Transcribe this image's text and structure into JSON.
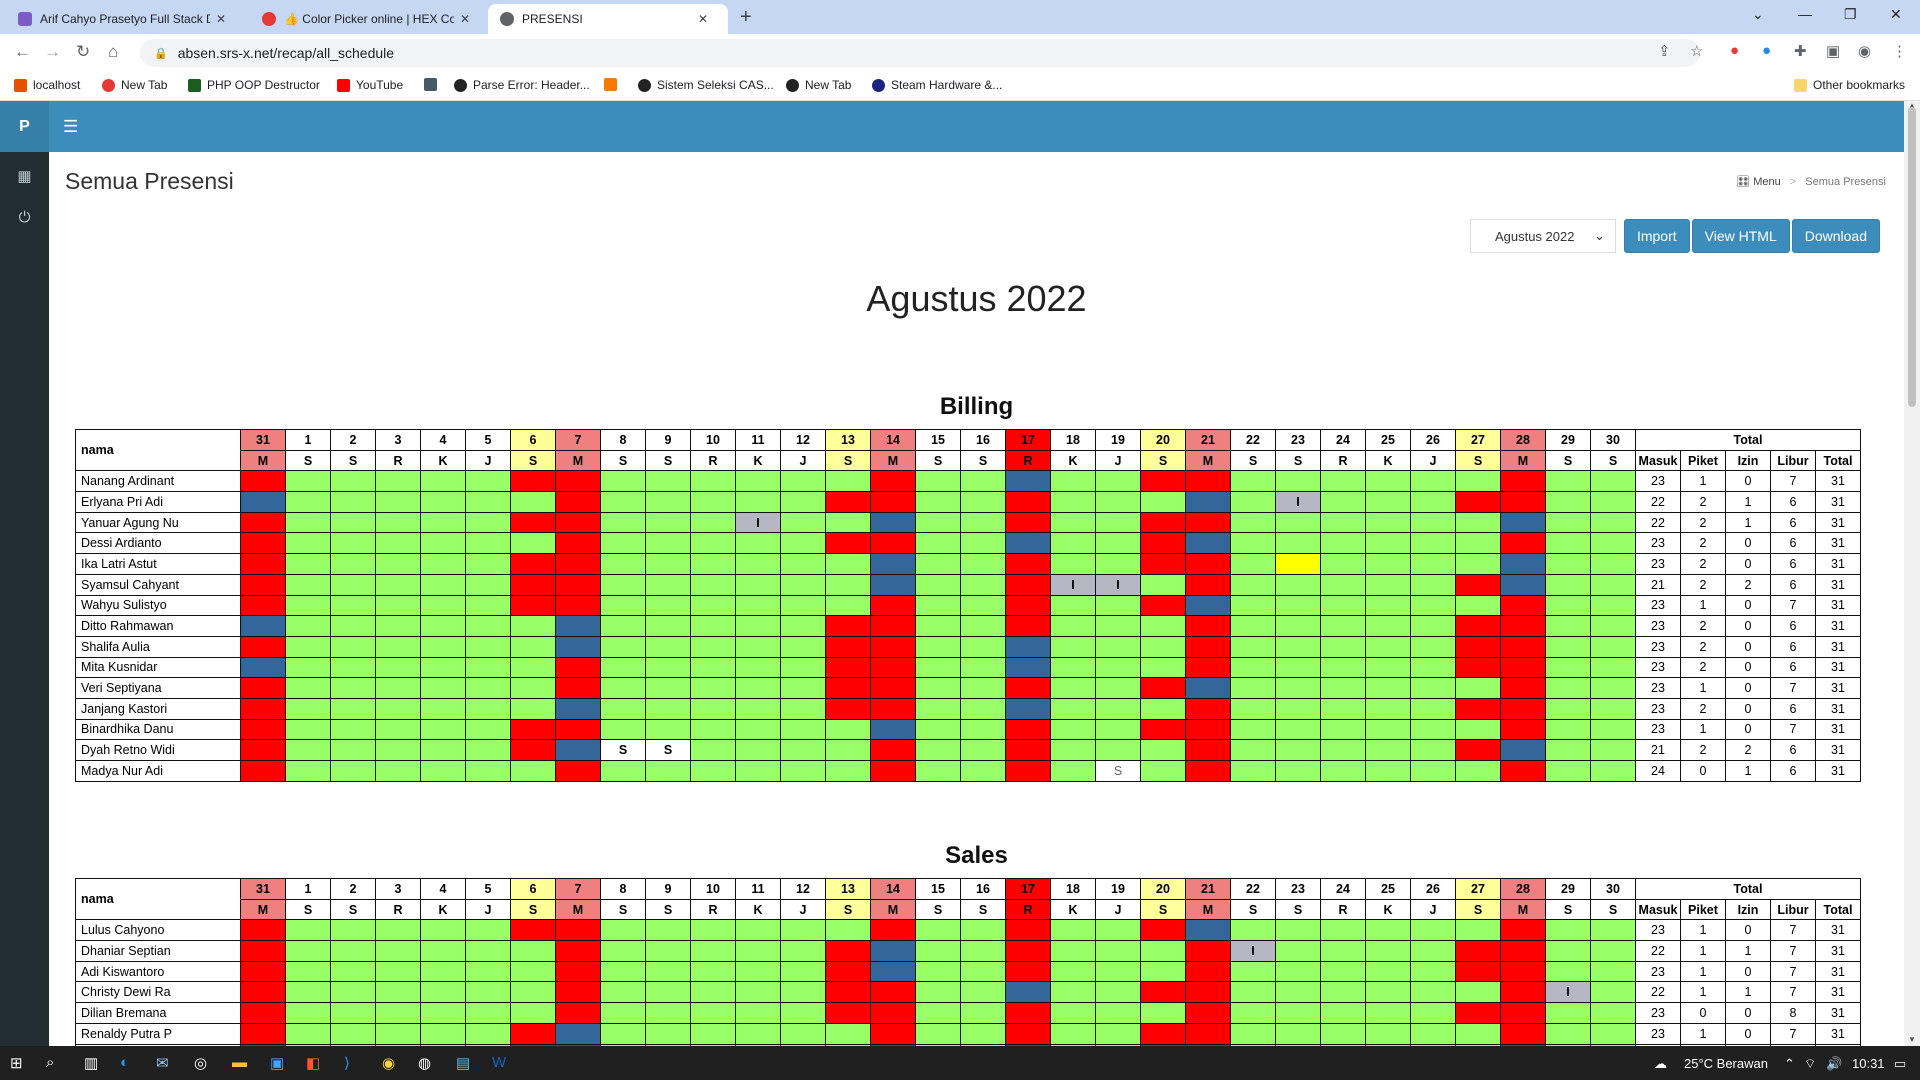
{
  "browser": {
    "tabs": [
      {
        "title": "Arif Cahyo Prasetyo Full Stack De",
        "color": "#7b5cc7"
      },
      {
        "title": "👍 Color Picker online | HEX Colo",
        "color": "#e53935"
      },
      {
        "title": "PRESENSI",
        "color": "#5f6368"
      }
    ],
    "url": "absen.srs-x.net/recap/all_schedule",
    "bookmarks": [
      {
        "label": "localhost",
        "color": "#e65100"
      },
      {
        "label": "New Tab",
        "color": "#e53935"
      },
      {
        "label": "PHP OOP Destructor",
        "color": "#1b5e20"
      },
      {
        "label": "YouTube",
        "color": "#ff0000"
      },
      {
        "label": "",
        "color": "#455a64"
      },
      {
        "label": "Parse Error: Header...",
        "color": "#222222"
      },
      {
        "label": "",
        "color": "#f57c00"
      },
      {
        "label": "Sistem Seleksi CAS...",
        "color": "#222222"
      },
      {
        "label": "New Tab",
        "color": "#222222"
      },
      {
        "label": "Steam Hardware &...",
        "color": "#1a237e"
      }
    ],
    "other_bookmarks": "Other bookmarks"
  },
  "app": {
    "brand": "P",
    "page_title": "Semua Presensi",
    "breadcrumb": {
      "menu": "Menu",
      "separator": ">",
      "current": "Semua Presensi"
    },
    "month_select": "Agustus 2022",
    "buttons": {
      "import": "Import",
      "view_html": "View HTML",
      "download": "Download"
    },
    "month_heading": "Agustus 2022"
  },
  "colors": {
    "R": "#ff0000",
    "B": "#336699",
    "G": "#99ff66",
    "Y": "#ffff00",
    "I": "#b7b7c4",
    "accent": "#3c8dbc"
  },
  "table_headers": {
    "name": "nama",
    "total": "Total",
    "summary": [
      "Masuk",
      "Piket",
      "Izin",
      "Libur",
      "Total"
    ],
    "days": [
      {
        "d": "31",
        "w": "M",
        "style": "hR"
      },
      {
        "d": "1",
        "w": "S",
        "style": ""
      },
      {
        "d": "2",
        "w": "S",
        "style": ""
      },
      {
        "d": "3",
        "w": "R",
        "style": ""
      },
      {
        "d": "4",
        "w": "K",
        "style": ""
      },
      {
        "d": "5",
        "w": "J",
        "style": ""
      },
      {
        "d": "6",
        "w": "S",
        "style": "hY"
      },
      {
        "d": "7",
        "w": "M",
        "style": "hR"
      },
      {
        "d": "8",
        "w": "S",
        "style": ""
      },
      {
        "d": "9",
        "w": "S",
        "style": ""
      },
      {
        "d": "10",
        "w": "R",
        "style": ""
      },
      {
        "d": "11",
        "w": "K",
        "style": ""
      },
      {
        "d": "12",
        "w": "J",
        "style": ""
      },
      {
        "d": "13",
        "w": "S",
        "style": "hY"
      },
      {
        "d": "14",
        "w": "M",
        "style": "hR"
      },
      {
        "d": "15",
        "w": "S",
        "style": ""
      },
      {
        "d": "16",
        "w": "S",
        "style": ""
      },
      {
        "d": "17",
        "w": "R",
        "style": "hRR"
      },
      {
        "d": "18",
        "w": "K",
        "style": ""
      },
      {
        "d": "19",
        "w": "J",
        "style": ""
      },
      {
        "d": "20",
        "w": "S",
        "style": "hY"
      },
      {
        "d": "21",
        "w": "M",
        "style": "hR"
      },
      {
        "d": "22",
        "w": "S",
        "style": ""
      },
      {
        "d": "23",
        "w": "S",
        "style": ""
      },
      {
        "d": "24",
        "w": "R",
        "style": ""
      },
      {
        "d": "25",
        "w": "K",
        "style": ""
      },
      {
        "d": "26",
        "w": "J",
        "style": ""
      },
      {
        "d": "27",
        "w": "S",
        "style": "hY"
      },
      {
        "d": "28",
        "w": "M",
        "style": "hR"
      },
      {
        "d": "29",
        "w": "S",
        "style": ""
      },
      {
        "d": "30",
        "w": "S",
        "style": ""
      }
    ]
  },
  "sections": [
    {
      "title": "Billing",
      "rows": [
        {
          "name": "Nanang Ardinant",
          "cells": "RGGGGGRRGGGGGGRGGBGGRRGGGGGGRGG",
          "marks": {},
          "summary": [
            23,
            1,
            0,
            7,
            31
          ]
        },
        {
          "name": "Erlyana Pri Adi",
          "cells": "BGGGGGGRGGGGGRRGGRGGGBGIGGGRRGG",
          "marks": {
            "23": "I"
          },
          "summary": [
            22,
            2,
            1,
            6,
            31
          ]
        },
        {
          "name": "Yanuar Agung Nu",
          "cells": "RGGGGGRRGGGIGGBGGRGGRRGGGGGGBGG",
          "marks": {
            "11": "I"
          },
          "summary": [
            22,
            2,
            1,
            6,
            31
          ]
        },
        {
          "name": "Dessi Ardianto",
          "cells": "RGGGGGGRGGGGGRRGGBGGRBGGGGGGRGG",
          "marks": {},
          "summary": [
            23,
            2,
            0,
            6,
            31
          ]
        },
        {
          "name": "Ika Latri Astut",
          "cells": "RGGGGGRRGGGGGGBGGRGGRRGYGGGGBGG",
          "marks": {},
          "summary": [
            23,
            2,
            0,
            6,
            31
          ]
        },
        {
          "name": "Syamsul Cahyant",
          "cells": "RGGGGGRRGGGGGGBGGRIIGRGGGGGRBGG",
          "marks": {
            "18": "I",
            "19": "I"
          },
          "summary": [
            21,
            2,
            2,
            6,
            31
          ]
        },
        {
          "name": "Wahyu Sulistyo",
          "cells": "RGGGGGRRGGGGGGRGGRGGRBGGGGGGRGG",
          "marks": {},
          "summary": [
            23,
            1,
            0,
            7,
            31
          ]
        },
        {
          "name": "Ditto Rahmawan",
          "cells": "BGGGGGGBGGGGGRRGGRGGGRGGGGGRRGG",
          "marks": {},
          "summary": [
            23,
            2,
            0,
            6,
            31
          ]
        },
        {
          "name": "Shalifa Aulia",
          "cells": "RGGGGGGBGGGGGRRGGBGGGRGGGGGRRGG",
          "marks": {},
          "summary": [
            23,
            2,
            0,
            6,
            31
          ]
        },
        {
          "name": "Mita Kusnidar",
          "cells": "BGGGGGGRGGGGGRRGGBGGGRGGGGGRRGG",
          "marks": {},
          "summary": [
            23,
            2,
            0,
            6,
            31
          ]
        },
        {
          "name": "Veri Septiyana",
          "cells": "RGGGGGGRGGGGGRRGGRGGRBGGGGGGRGG",
          "marks": {},
          "summary": [
            23,
            1,
            0,
            7,
            31
          ]
        },
        {
          "name": "Janjang Kastori",
          "cells": "RGGGGGGBGGGGGRRGGBGGGRGGGGGRRGG",
          "marks": {},
          "summary": [
            23,
            2,
            0,
            6,
            31
          ]
        },
        {
          "name": "Binardhika Danu",
          "cells": "RGGGGGRRGGGGGGBGGRGGRRGGGGGGRGG",
          "marks": {},
          "summary": [
            23,
            1,
            0,
            7,
            31
          ]
        },
        {
          "name": "Dyah Retno Widi",
          "cells": "RGGGGGRBWWGGGGRGGRGGGRGGGGGRBGG",
          "marks": {
            "8": "S",
            "9": "S"
          },
          "summary": [
            21,
            2,
            2,
            6,
            31
          ]
        },
        {
          "name": "Madya Nur Adi",
          "cells": "RGGGGGGRGGGGGGRGGRGSGRGGGGGGRGG",
          "marks": {
            "19": "S"
          },
          "summary": [
            24,
            0,
            1,
            6,
            31
          ]
        }
      ]
    },
    {
      "title": "Sales",
      "rows": [
        {
          "name": "Lulus Cahyono",
          "cells": "RGGGGGRRGGGGGGRGGRGGRBGGGGGGRGG",
          "marks": {},
          "summary": [
            23,
            1,
            0,
            7,
            31
          ]
        },
        {
          "name": "Dhaniar Septian",
          "cells": "RGGGGGGRGGGGGRBGGRGGGRIGGGGRRGG",
          "marks": {
            "22": "I"
          },
          "summary": [
            22,
            1,
            1,
            7,
            31
          ]
        },
        {
          "name": "Adi Kiswantoro",
          "cells": "RGGGGGGRGGGGGRBGGRGGGRGGGGGRRGG",
          "marks": {},
          "summary": [
            23,
            1,
            0,
            7,
            31
          ]
        },
        {
          "name": "Christy Dewi Ra",
          "cells": "RGGGGGGRGGGGGRRGGBGGRRGGGGGGRIG",
          "marks": {
            "29": "I"
          },
          "summary": [
            22,
            1,
            1,
            7,
            31
          ]
        },
        {
          "name": "Dilian Bremana",
          "cells": "RGGGGGGRGGGGGRRGGRGGGRGGGGGRRGG",
          "marks": {},
          "summary": [
            23,
            0,
            0,
            8,
            31
          ]
        },
        {
          "name": "Renaldy Putra P",
          "cells": "RGGGGGRBGGGGGGRGGRGGRRGGGGGGRGG",
          "marks": {},
          "summary": [
            23,
            1,
            0,
            7,
            31
          ]
        },
        {
          "name": "",
          "cells": "RGGGGGRRGGGGGGRGGRGGRRGGGGGGRGG",
          "marks": {},
          "summary": [
            "",
            "",
            "",
            "",
            ""
          ]
        }
      ]
    }
  ],
  "taskbar": {
    "weather": "25°C  Berawan",
    "time": "10:31"
  }
}
